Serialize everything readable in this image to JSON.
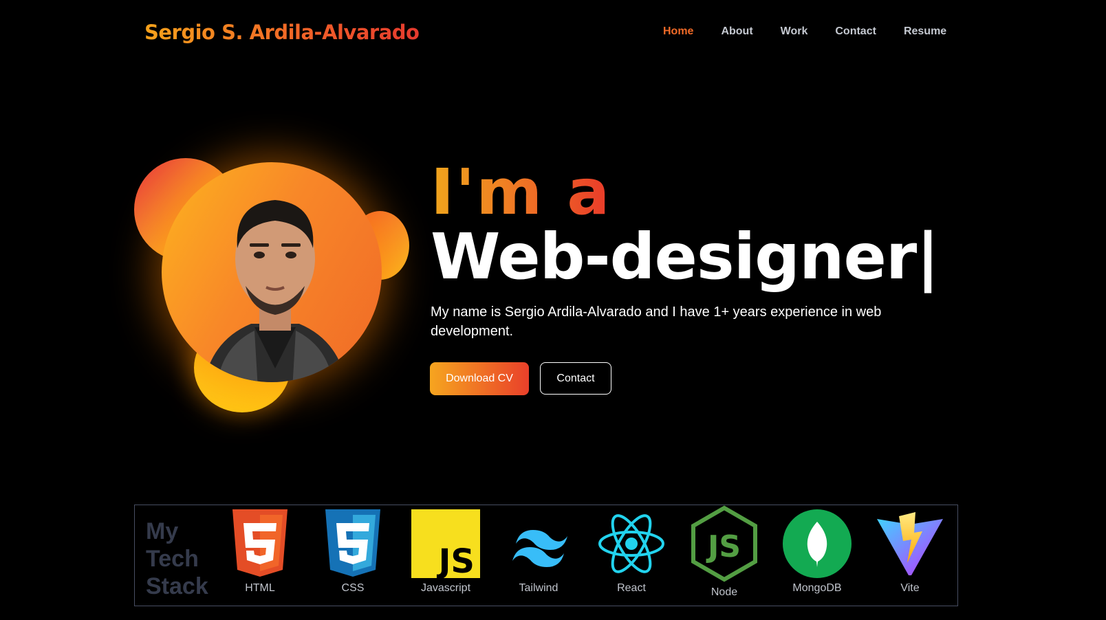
{
  "header": {
    "brand": "Sergio S. Ardila-Alvarado",
    "nav": [
      {
        "label": "Home",
        "active": true
      },
      {
        "label": "About"
      },
      {
        "label": "Work"
      },
      {
        "label": "Contact"
      },
      {
        "label": "Resume"
      }
    ]
  },
  "hero": {
    "prefix": "I'm a",
    "role": "Web-designer|",
    "description": "My name is Sergio Ardila-Alvarado and I have 1+ years experience in web development.",
    "download_label": "Download CV",
    "contact_label": "Contact"
  },
  "tech_stack": {
    "title_lines": [
      "My",
      "Tech",
      "Stack"
    ],
    "items": [
      {
        "label": "HTML",
        "icon": "html5-icon"
      },
      {
        "label": "CSS",
        "icon": "css3-icon"
      },
      {
        "label": "Javascript",
        "icon": "javascript-icon"
      },
      {
        "label": "Tailwind",
        "icon": "tailwind-icon"
      },
      {
        "label": "React",
        "icon": "react-icon"
      },
      {
        "label": "Node",
        "icon": "nodejs-icon"
      },
      {
        "label": "MongoDB",
        "icon": "mongodb-icon"
      },
      {
        "label": "Vite",
        "icon": "vite-icon"
      }
    ]
  },
  "colors": {
    "accent_orange": "#f06a27",
    "accent_yellow": "#fdb31f",
    "accent_red": "#e93a2a",
    "background": "#000000"
  }
}
